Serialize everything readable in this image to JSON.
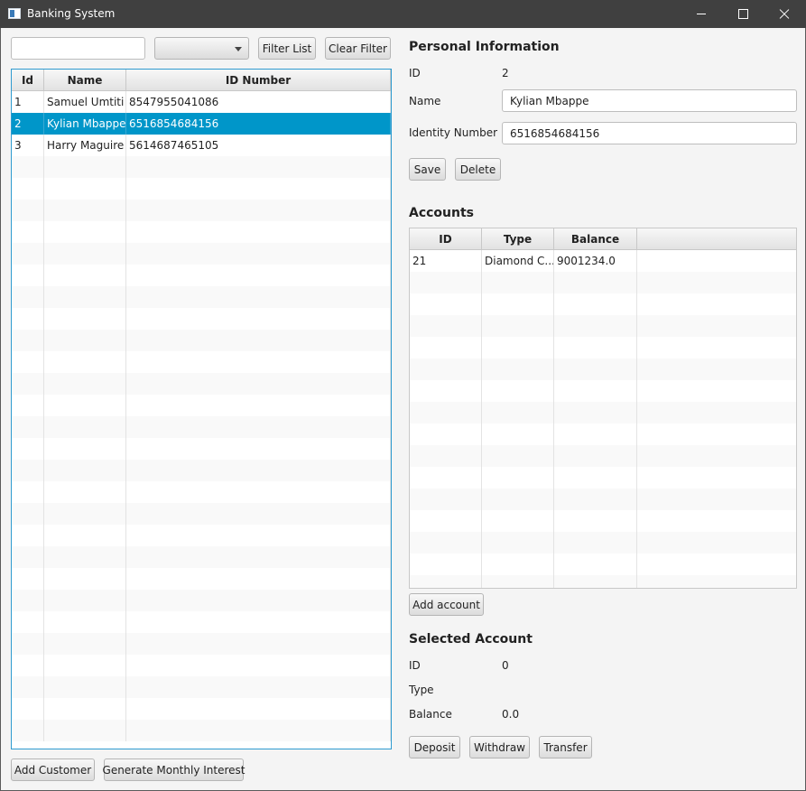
{
  "window": {
    "title": "Banking System"
  },
  "customers": {
    "filter_value": "",
    "combo_value": "",
    "filter_button": "Filter List",
    "clear_button": "Clear Filter",
    "columns": [
      "Id",
      "Name",
      "ID Number"
    ],
    "rows": [
      {
        "id": "1",
        "name": "Samuel Umtiti",
        "id_number": "8547955041086"
      },
      {
        "id": "2",
        "name": "Kylian Mbappe",
        "id_number": "6516854684156"
      },
      {
        "id": "3",
        "name": "Harry Maguire",
        "id_number": "5614687465105"
      }
    ],
    "add_button": "Add Customer",
    "interest_button": "Generate Monthly Interest"
  },
  "personal": {
    "heading": "Personal Information",
    "id_label": "ID",
    "id_value": "2",
    "name_label": "Name",
    "name_value": "Kylian Mbappe",
    "idnum_label": "Identity Number",
    "idnum_value": "6516854684156",
    "save_button": "Save",
    "delete_button": "Delete"
  },
  "accounts": {
    "heading": "Accounts",
    "columns": [
      "ID",
      "Type",
      "Balance"
    ],
    "rows": [
      {
        "id": "21",
        "type": "Diamond C...",
        "balance": "9001234.0"
      }
    ],
    "add_button": "Add account"
  },
  "selected_account": {
    "heading": "Selected Account",
    "id_label": "ID",
    "id_value": "0",
    "type_label": "Type",
    "type_value": "",
    "balance_label": "Balance",
    "balance_value": "0.0",
    "deposit_button": "Deposit",
    "withdraw_button": "Withdraw",
    "transfer_button": "Transfer"
  },
  "colors": {
    "selection": "#0096c9",
    "titlebar": "#404040",
    "focus_border": "#2f9bd0"
  }
}
